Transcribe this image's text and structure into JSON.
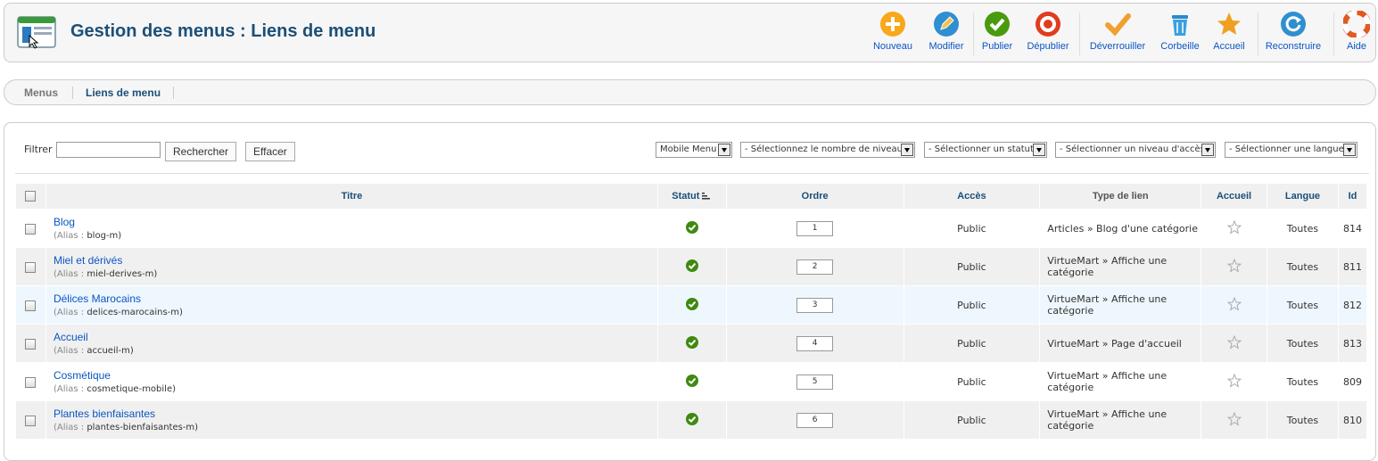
{
  "header": {
    "title": "Gestion des menus : Liens de menu"
  },
  "toolbar": {
    "buttons": [
      {
        "label": "Nouveau",
        "icon": "plus-icon",
        "color": "#f7a81b"
      },
      {
        "label": "Modifier",
        "icon": "pencil-icon",
        "color": "#2f8fd0"
      },
      {
        "label": "Publier",
        "icon": "check-icon",
        "color": "#4a9a10"
      },
      {
        "label": "Dépublier",
        "icon": "stop-icon",
        "color": "#e03c1f"
      },
      {
        "label": "Déverrouiller",
        "icon": "checkmark-icon",
        "color": "#f0a030"
      },
      {
        "label": "Corbeille",
        "icon": "trash-icon",
        "color": "#3aa0e0"
      },
      {
        "label": "Accueil",
        "icon": "star-icon",
        "color": "#f0a020"
      },
      {
        "label": "Reconstruire",
        "icon": "refresh-icon",
        "color": "#2f8fd0"
      },
      {
        "label": "Aide",
        "icon": "help-icon",
        "color": "#e05a1f"
      }
    ]
  },
  "subnav": {
    "tabs": [
      {
        "label": "Menus"
      },
      {
        "label": "Liens de menu"
      }
    ]
  },
  "filters": {
    "filter_label": "Filtrer :",
    "search_value": "",
    "search_button": "Rechercher",
    "clear_button": "Effacer",
    "selects": [
      "Mobile Menu",
      "- Sélectionnez le nombre de niveaux -",
      "- Sélectionner un statut -",
      "- Sélectionner un niveau d'accès -",
      "- Sélectionner une langue -"
    ]
  },
  "table": {
    "headers": {
      "title": "Titre",
      "status": "Statut",
      "order": "Ordre",
      "access": "Accès",
      "type": "Type de lien",
      "home": "Accueil",
      "language": "Langue",
      "id": "Id"
    },
    "alias_label": "(Alias :",
    "rows": [
      {
        "title": "Blog",
        "alias": "blog-m)",
        "order": "1",
        "access": "Public",
        "type": "Articles » Blog d'une catégorie",
        "language": "Toutes",
        "id": "814"
      },
      {
        "title": "Miel et dérivés",
        "alias": "miel-derives-m)",
        "order": "2",
        "access": "Public",
        "type": "VirtueMart » Affiche une catégorie",
        "language": "Toutes",
        "id": "811"
      },
      {
        "title": "Délices Marocains",
        "alias": "delices-marocains-m)",
        "order": "3",
        "access": "Public",
        "type": "VirtueMart » Affiche une catégorie",
        "language": "Toutes",
        "id": "812"
      },
      {
        "title": "Accueil",
        "alias": "accueil-m)",
        "order": "4",
        "access": "Public",
        "type": "VirtueMart » Page d'accueil",
        "language": "Toutes",
        "id": "813"
      },
      {
        "title": "Cosmétique",
        "alias": "cosmetique-mobile)",
        "order": "5",
        "access": "Public",
        "type": "VirtueMart » Affiche une catégorie",
        "language": "Toutes",
        "id": "809"
      },
      {
        "title": "Plantes bienfaisantes",
        "alias": "plantes-bienfaisantes-m)",
        "order": "6",
        "access": "Public",
        "type": "VirtueMart » Affiche une catégorie",
        "language": "Toutes",
        "id": "810"
      }
    ]
  }
}
